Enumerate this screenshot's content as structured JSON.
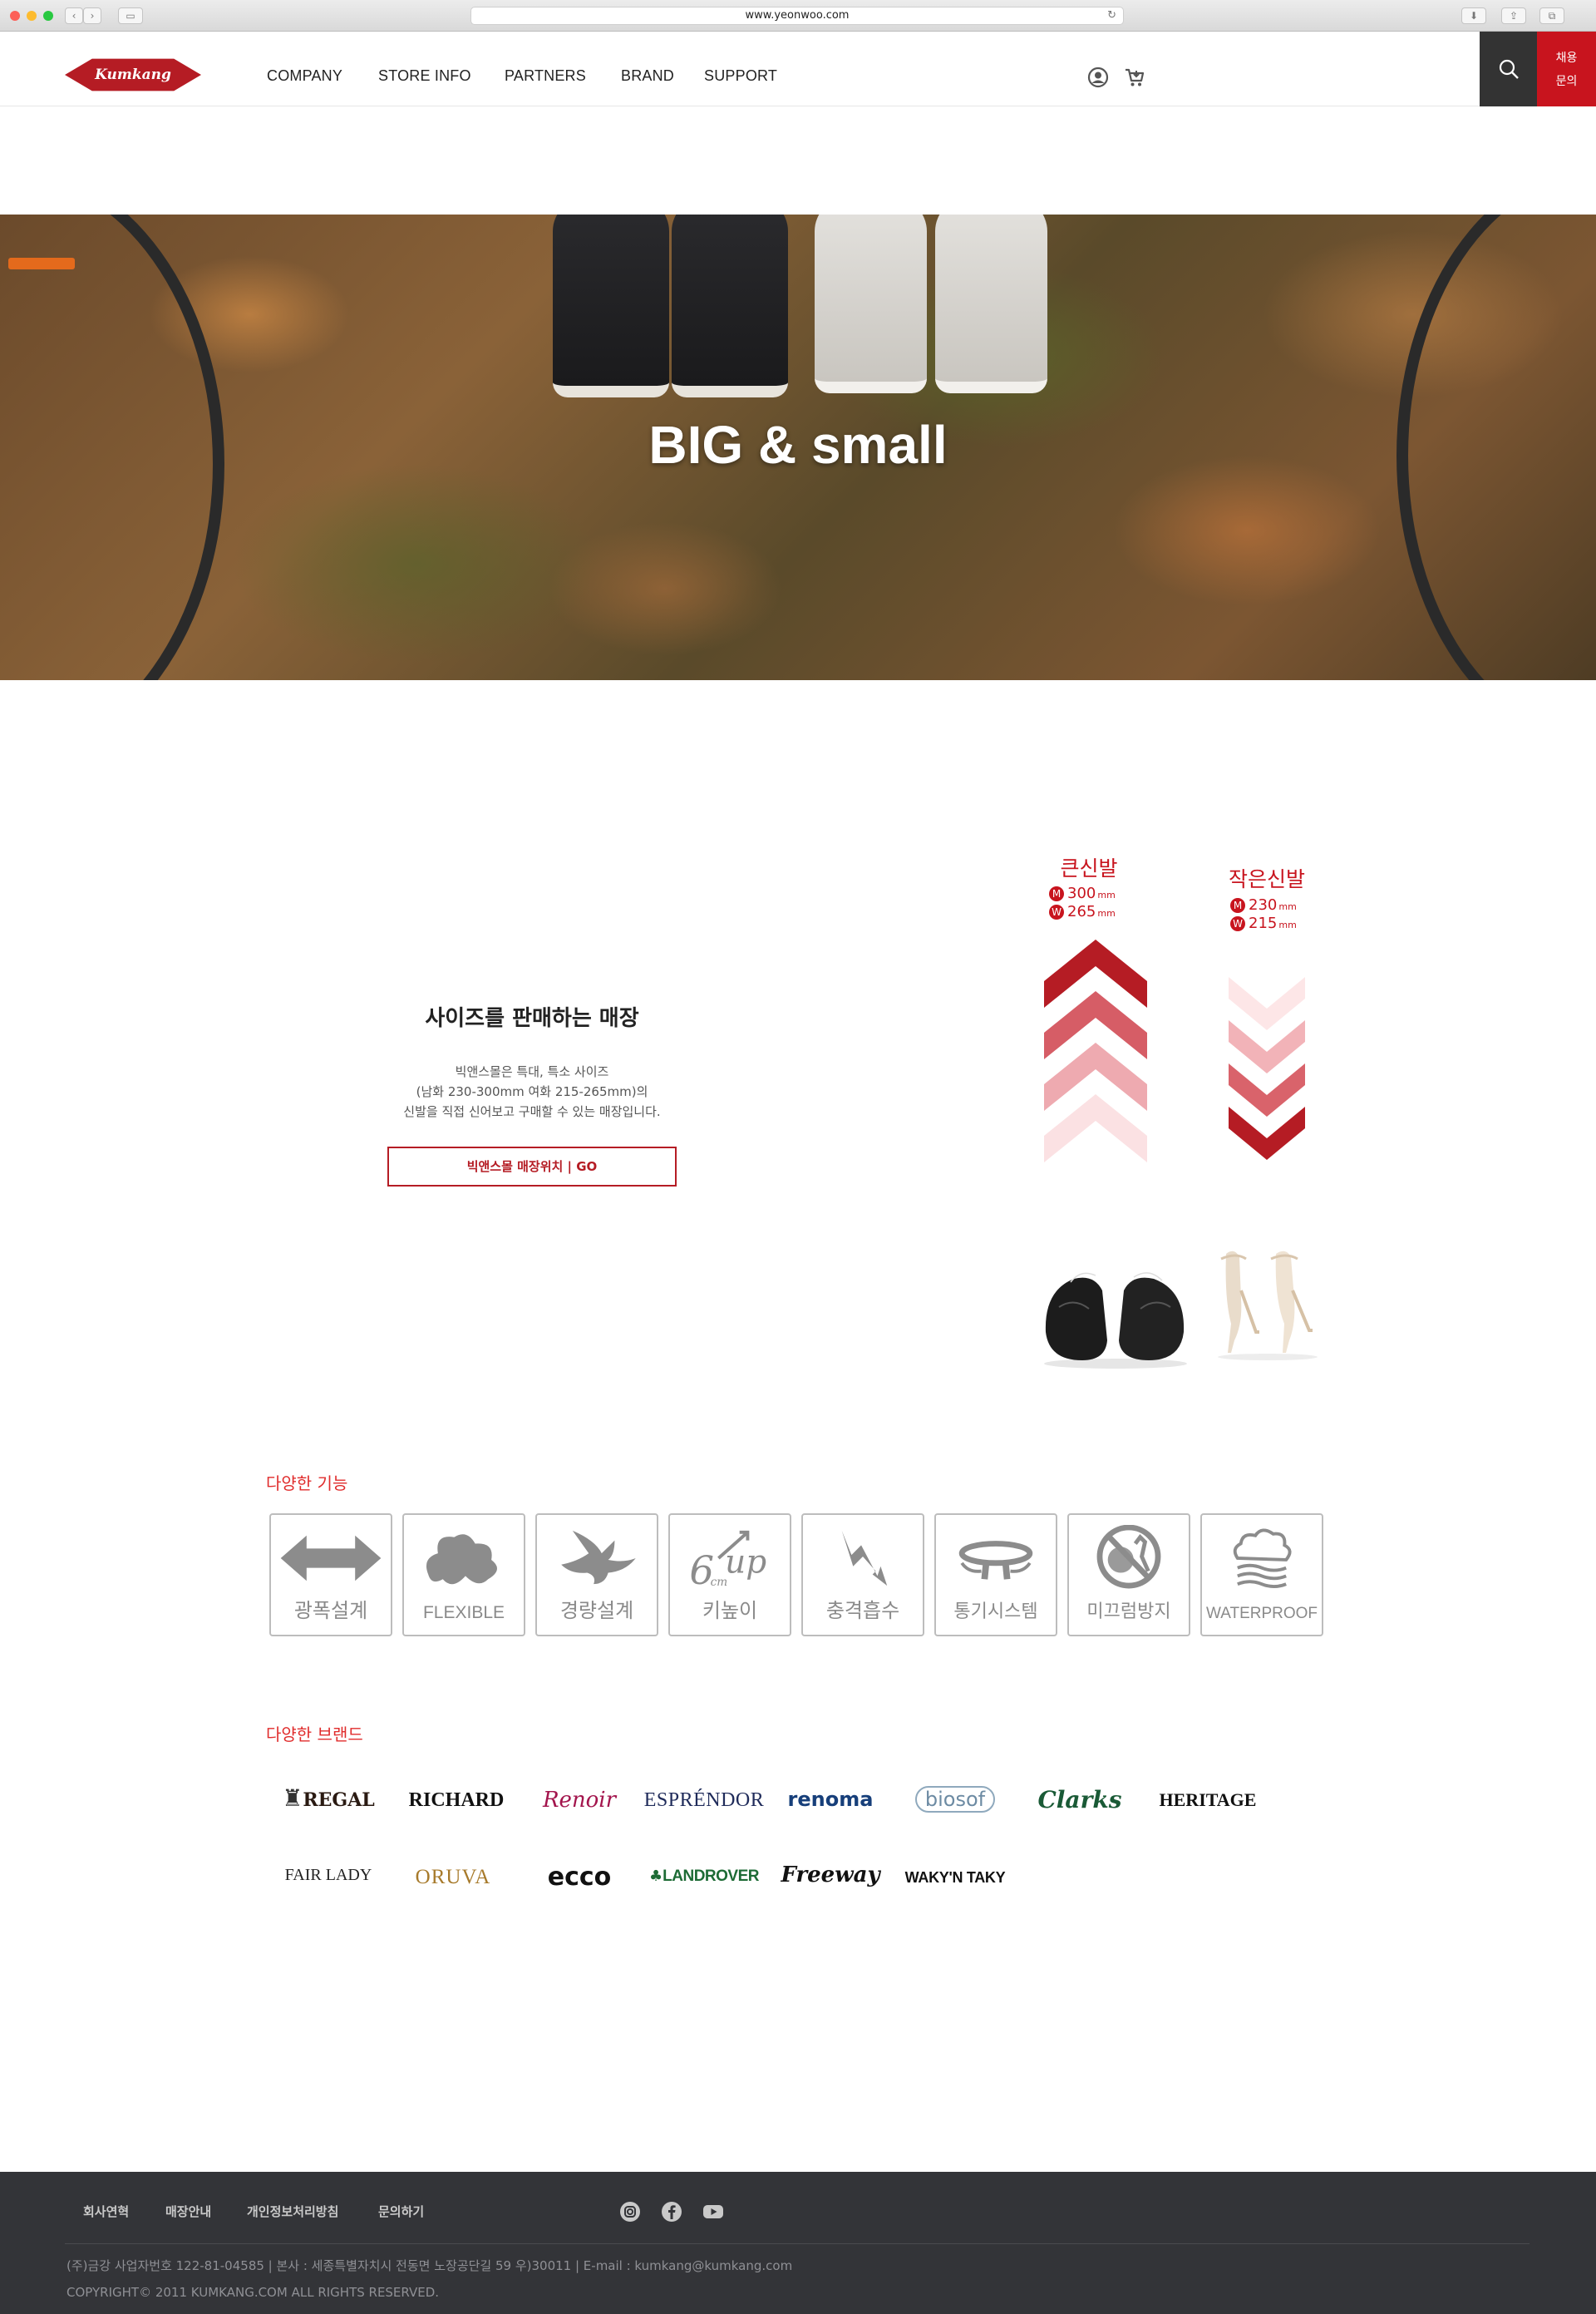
{
  "browser": {
    "url": "www.yeonwoo.com"
  },
  "header": {
    "logo_text": "Kumkang",
    "nav": [
      "COMPANY",
      "STORE INFO",
      "PARTNERS",
      "BRAND",
      "SUPPORT"
    ],
    "recruit_line1": "채용",
    "recruit_line2": "문의"
  },
  "hero": {
    "title": "BIG & small"
  },
  "size_store": {
    "title": "사이즈를 판매하는 매장",
    "desc_lines": [
      "빅앤스몰은 특대, 특소 사이즈",
      "(남화 230-300mm 여화 215-265mm)의",
      "신발을 직접 신어보고 구매할 수 있는 매장입니다."
    ],
    "button": "빅앤스몰 매장위치 | GO",
    "big": {
      "label": "큰신발",
      "m_mark": "M",
      "w_mark": "W",
      "m": "300",
      "w": "265",
      "unit": "mm"
    },
    "small": {
      "label": "작은신발",
      "m_mark": "M",
      "w_mark": "W",
      "m": "230",
      "w": "215",
      "unit": "mm"
    },
    "colors": {
      "accent": "#c8141e",
      "light": "#f3c7c9"
    }
  },
  "features": {
    "title": "다양한 기능",
    "items": [
      {
        "label": "광폭설계",
        "icon": "wide-arrow-icon"
      },
      {
        "label": "FLEXIBLE",
        "icon": "flexible-icon"
      },
      {
        "label": "경량설계",
        "icon": "bird-icon"
      },
      {
        "label": "키높이",
        "icon": "height-up-icon",
        "art": "6cm up"
      },
      {
        "label": "충격흡수",
        "icon": "shock-icon"
      },
      {
        "label": "통기시스템",
        "icon": "air-icon"
      },
      {
        "label": "미끄럼방지",
        "icon": "anti-slip-icon"
      },
      {
        "label": "WATERPROOF",
        "icon": "waterproof-icon"
      }
    ]
  },
  "brands": {
    "title": "다양한 브랜드",
    "row1": [
      "REGAL",
      "RICHARD",
      "Renoir",
      "ESPRÉNDOR",
      "renoma",
      "biosof",
      "Clarks",
      "HERITAGE"
    ],
    "row2": [
      "FAIR LADY",
      "ORUVA",
      "ecco",
      "LANDROVER",
      "Freeway",
      "WAKY'N TAKY"
    ]
  },
  "footer": {
    "links": [
      "회사연혁",
      "매장안내",
      "개인정보처리방침",
      "문의하기"
    ],
    "social": [
      "instagram-icon",
      "facebook-icon",
      "youtube-icon"
    ],
    "address": "(주)금강 사업자번호 122-81-04585 | 본사 : 세종특별자치시 전동면 노장공단길 59 우)30011 | E-mail : kumkang@kumkang.com",
    "copyright": "COPYRIGHT© 2011 KUMKANG.COM ALL RIGHTS RESERVED."
  }
}
